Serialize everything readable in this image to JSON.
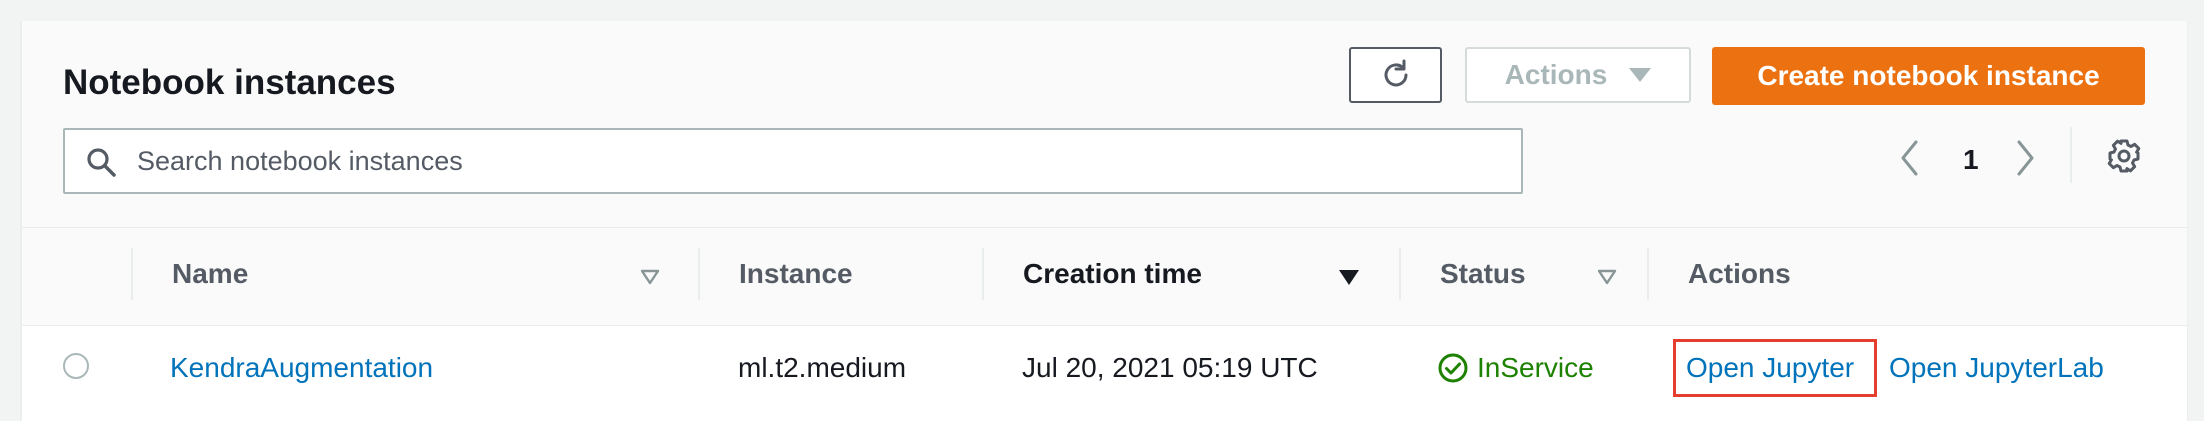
{
  "header": {
    "title": "Notebook instances",
    "actions_label": "Actions",
    "create_label": "Create notebook instance"
  },
  "search": {
    "placeholder": "Search notebook instances"
  },
  "pagination": {
    "current_page": "1"
  },
  "table": {
    "columns": [
      {
        "label": "Name",
        "sortable": true
      },
      {
        "label": "Instance",
        "sortable": false
      },
      {
        "label": "Creation time",
        "sortable": true,
        "sorted": "descending"
      },
      {
        "label": "Status",
        "sortable": true
      },
      {
        "label": "Actions",
        "sortable": false
      }
    ],
    "rows": [
      {
        "name": "KendraAugmentation",
        "instance": "ml.t2.medium",
        "creation_time": "Jul 20, 2021 05:19 UTC",
        "status": "InService",
        "actions": [
          "Open Jupyter",
          "Open JupyterLab"
        ]
      }
    ]
  },
  "colors": {
    "accent": "#ec7211",
    "link": "#0073bb",
    "status_ok": "#1d8102",
    "highlight_box": "#e53e2e"
  },
  "icons": {
    "refresh": "refresh-icon",
    "actions_caret": "caret-down-icon",
    "search": "search-icon",
    "prev": "chevron-left-icon",
    "next": "chevron-right-icon",
    "settings": "gear-icon",
    "sort_inactive": "sort-outline-icon",
    "sort_active": "sort-filled-icon",
    "status_ok": "check-circle-icon"
  }
}
